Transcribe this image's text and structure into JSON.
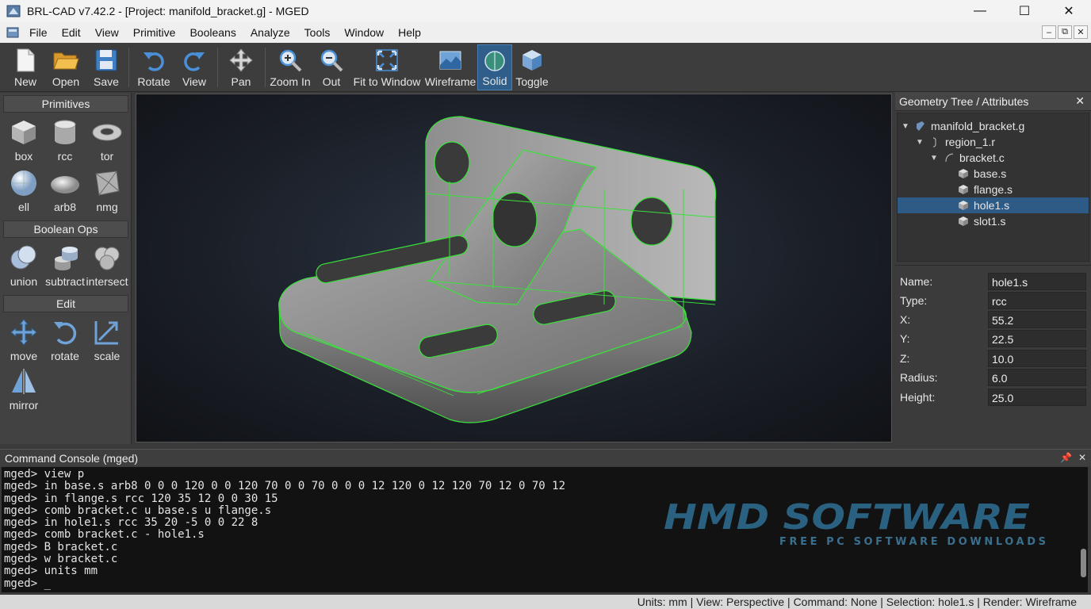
{
  "window": {
    "title": "BRL-CAD v7.42.2 - [Project: manifold_bracket.g] - MGED",
    "minimize": "—",
    "maximize": "☐",
    "close": "✕"
  },
  "menu": {
    "items": [
      "File",
      "Edit",
      "View",
      "Primitive",
      "Booleans",
      "Analyze",
      "Tools",
      "Window",
      "Help"
    ],
    "mdi": [
      "–",
      "⧉",
      "✕"
    ]
  },
  "toolbar": {
    "buttons": [
      {
        "label": "New",
        "icon": "new-file-icon"
      },
      {
        "label": "Open",
        "icon": "open-folder-icon"
      },
      {
        "label": "Save",
        "icon": "save-disk-icon"
      },
      {
        "label": "Rotate",
        "icon": "rotate-icon"
      },
      {
        "label": "View",
        "icon": "view-redo-icon"
      },
      {
        "label": "Pan",
        "icon": "pan-arrows-icon"
      },
      {
        "label": "Zoom In",
        "icon": "zoom-in-icon"
      },
      {
        "label": "Out",
        "icon": "zoom-out-icon"
      },
      {
        "label": "Fit to Window",
        "icon": "fit-window-icon"
      },
      {
        "label": "Wireframe",
        "icon": "wireframe-icon"
      },
      {
        "label": "Solid",
        "icon": "solid-icon",
        "active": true
      },
      {
        "label": "Toggle",
        "icon": "cube-toggle-icon"
      }
    ]
  },
  "palette": {
    "sections": {
      "primitives": "Primitives",
      "boolean": "Boolean Ops",
      "edit": "Edit"
    },
    "primitives": [
      "box",
      "rcc",
      "tor",
      "ell",
      "arb8",
      "nmg"
    ],
    "boolean": [
      "union",
      "subtract",
      "intersect"
    ],
    "edit": [
      "move",
      "rotate",
      "scale",
      "mirror"
    ]
  },
  "tree": {
    "header": "Geometry Tree / Attributes",
    "close": "✕",
    "nodes": [
      {
        "label": "manifold_bracket.g",
        "icon": "database-icon"
      },
      {
        "label": "region_1.r",
        "icon": "region-icon"
      },
      {
        "label": "bracket.c",
        "icon": "combination-icon"
      },
      {
        "label": "base.s",
        "icon": "solid-primitive-icon"
      },
      {
        "label": "flange.s",
        "icon": "solid-primitive-icon"
      },
      {
        "label": "hole1.s",
        "icon": "solid-primitive-icon",
        "selected": true
      },
      {
        "label": "slot1.s",
        "icon": "solid-primitive-icon"
      }
    ]
  },
  "attributes": [
    {
      "key": "Name:",
      "value": "hole1.s"
    },
    {
      "key": "Type:",
      "value": "rcc"
    },
    {
      "key": "X:",
      "value": "55.2"
    },
    {
      "key": "Y:",
      "value": "22.5"
    },
    {
      "key": "Z:",
      "value": "10.0"
    },
    {
      "key": "Radius:",
      "value": "6.0"
    },
    {
      "key": "Height:",
      "value": "25.0"
    }
  ],
  "console": {
    "header": "Command Console (mged)",
    "pin": "📌",
    "close": "✕",
    "lines": [
      "mged> view p",
      "mged> in base.s arb8 0 0 0 120 0 0 120 70 0 0 70 0 0 0 12 120 0 12 120 70 12 0 70 12",
      "mged> in flange.s rcc 120 35 12 0 0 30 15",
      "mged> comb bracket.c u base.s u flange.s",
      "mged> in hole1.s rcc 35 20 -5 0 0 22 8",
      "mged> comb bracket.c - hole1.s",
      "mged> B bracket.c",
      "mged> w bracket.c",
      "mged> units mm",
      "mged> _"
    ]
  },
  "watermark": {
    "logo": "HMD SOFTWARE",
    "tagline": "FREE PC SOFTWARE DOWNLOADS"
  },
  "status": {
    "text": "Units: mm | View: Perspective | Command: None | Selection: hole1.s | Render: Wireframe"
  },
  "colors": {
    "accent": "#2f5e8a",
    "wire": "#39e23a",
    "viewport_bg": "#1a1e26"
  }
}
